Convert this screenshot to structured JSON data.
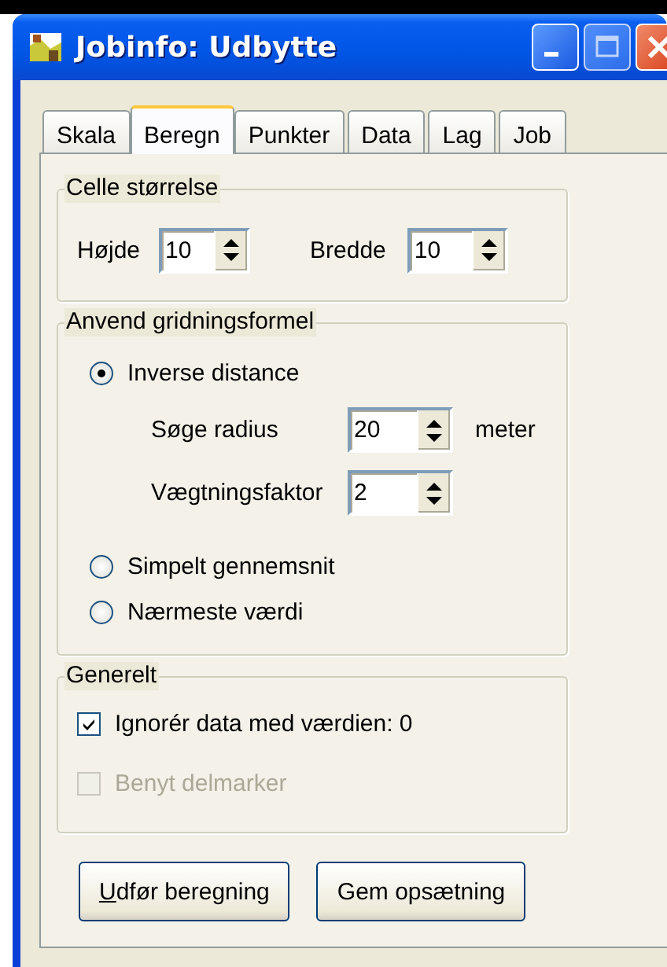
{
  "window": {
    "title": "Jobinfo: Udbytte"
  },
  "tabs": [
    {
      "label": "Skala",
      "selected": false
    },
    {
      "label": "Beregn",
      "selected": true
    },
    {
      "label": "Punkter",
      "selected": false
    },
    {
      "label": "Data",
      "selected": false
    },
    {
      "label": "Lag",
      "selected": false
    },
    {
      "label": "Job",
      "selected": false
    }
  ],
  "cell_size": {
    "title": "Celle størrelse",
    "fields": [
      {
        "label": "Højde",
        "value": "10"
      },
      {
        "label": "Bredde",
        "value": "10"
      }
    ]
  },
  "gridding": {
    "title": "Anvend gridningsformel",
    "options": [
      {
        "label": "Inverse distance",
        "selected": true,
        "settings": [
          {
            "label": "Søge radius",
            "value": "20",
            "unit": "meter"
          },
          {
            "label": "Vægtningsfaktor",
            "value": "2"
          }
        ]
      },
      {
        "label": "Simpelt gennemsnit",
        "selected": false
      },
      {
        "label": "Nærmeste værdi",
        "selected": false
      }
    ]
  },
  "general": {
    "title": "Generelt",
    "checkboxes": [
      {
        "label": "Ignorér data med værdien: 0",
        "checked": true,
        "disabled": false
      },
      {
        "label": "Benyt delmarker",
        "checked": false,
        "disabled": true
      }
    ]
  },
  "buttons": [
    {
      "label": "Udfør beregning",
      "mnemonic_underlined": true
    },
    {
      "label": "Gem opsætning"
    }
  ]
}
